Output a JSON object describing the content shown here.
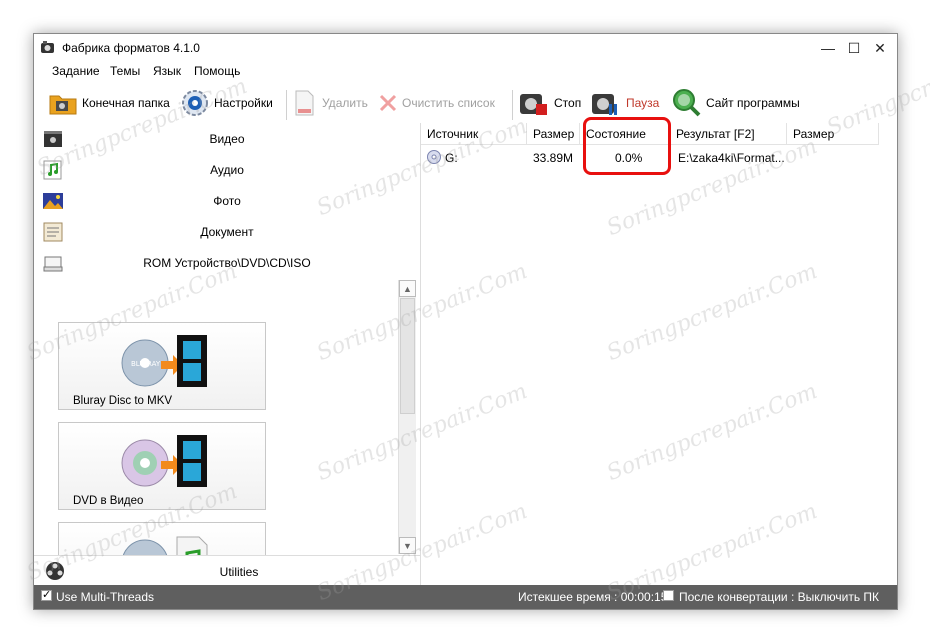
{
  "window": {
    "title": "Фабрика форматов 4.1.0"
  },
  "menu": [
    "Задание",
    "Темы",
    "Язык",
    "Помощь"
  ],
  "toolbar": {
    "output_folder": "Конечная папка",
    "settings": "Настройки",
    "delete": "Удалить",
    "clear_list": "Очистить список",
    "stop": "Стоп",
    "pause": "Пауза",
    "website": "Сайт программы"
  },
  "categories": [
    "Видео",
    "Аудио",
    "Фото",
    "Документ",
    "ROM Устройство\\DVD\\CD\\ISO"
  ],
  "tiles": [
    "Bluray Disc to MKV",
    "DVD в Видео",
    ""
  ],
  "utilities": "Utilities",
  "table": {
    "headers": [
      "Источник",
      "Размер",
      "Состояние",
      "Результат [F2]",
      "Размер"
    ],
    "rows": [
      {
        "source": "G:",
        "size": "33.89M",
        "status": "0.0%",
        "result": "E:\\zaka4ki\\Format...",
        "out_size": ""
      }
    ]
  },
  "statusbar": {
    "multithreads": "Use Multi-Threads",
    "multithreads_checked": true,
    "elapsed": "Истекшее время : 00:00:15",
    "after_convert": "После конвертации : Выключить ПК",
    "after_convert_checked": false
  },
  "watermark": "Soringpcrepair.Com",
  "colors": {
    "highlight": "#e8100f",
    "statusbar": "#5f5f5f",
    "pause": "#c0392b"
  }
}
